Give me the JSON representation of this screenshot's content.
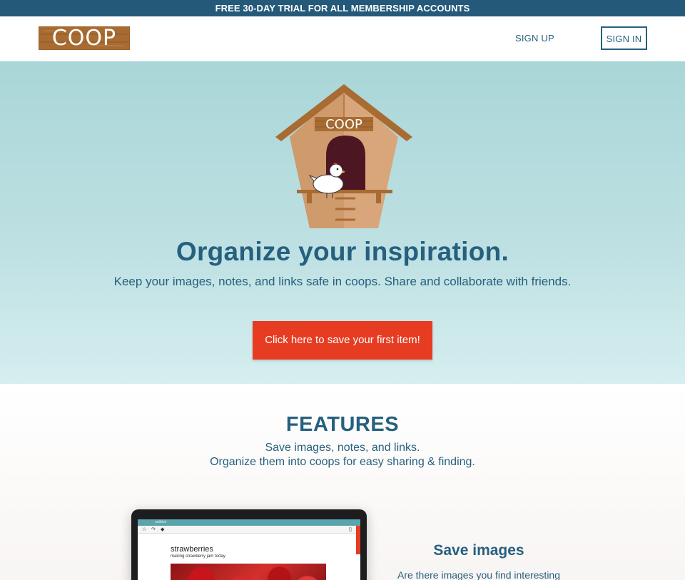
{
  "banner": {
    "text": "FREE 30-DAY TRIAL FOR ALL MEMBERSHIP ACCOUNTS"
  },
  "nav": {
    "logo_text": "COOP",
    "signup_label": "SIGN UP",
    "signin_label": "SIGN IN"
  },
  "hero": {
    "coop_sign": "COOP",
    "title": "Organize your inspiration.",
    "subtitle": "Keep your images, notes, and links safe in coops. Share and collaborate with friends.",
    "cta_label": "Click here to save your first item!"
  },
  "features": {
    "title": "FEATURES",
    "line1": "Save images, notes, and links.",
    "line2": "Organize them into coops for easy sharing & finding.",
    "mockup": {
      "window_label": "untitled",
      "item_title": "strawberries",
      "item_subtitle": "making strawberry jam today"
    },
    "save_images": {
      "title": "Save images",
      "description": "Are there images you find interesting"
    }
  },
  "colors": {
    "banner_bg": "#25597a",
    "primary_text": "#26607f",
    "cta_bg": "#e63c22",
    "hero_bg": "#a9d6d8",
    "wood": "#a86b32"
  }
}
